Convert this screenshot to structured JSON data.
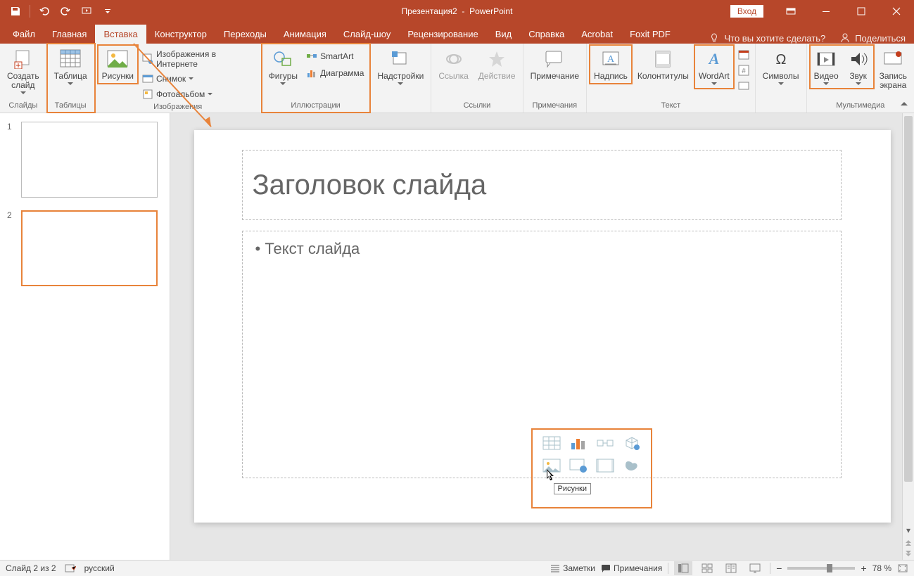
{
  "title": {
    "doc": "Презентация2",
    "app": "PowerPoint",
    "signin": "Вход"
  },
  "qat": {
    "save": "save",
    "undo": "undo",
    "redo": "redo",
    "start": "start"
  },
  "tabs": {
    "file": "Файл",
    "home": "Главная",
    "insert": "Вставка",
    "design": "Конструктор",
    "transitions": "Переходы",
    "animations": "Анимация",
    "slideshow": "Слайд-шоу",
    "review": "Рецензирование",
    "view": "Вид",
    "help": "Справка",
    "acrobat": "Acrobat",
    "foxit": "Foxit PDF",
    "tellme": "Что вы хотите сделать?",
    "share": "Поделиться"
  },
  "ribbon": {
    "groups": {
      "slides": {
        "label": "Слайды",
        "newslide": "Создать\nслайд"
      },
      "tables": {
        "label": "Таблицы",
        "table": "Таблица"
      },
      "images": {
        "label": "Изображения",
        "pictures": "Рисунки",
        "online": "Изображения в Интернете",
        "screenshot": "Снимок",
        "album": "Фотоальбом"
      },
      "illustrations": {
        "label": "Иллюстрации",
        "shapes": "Фигуры",
        "smartart": "SmartArt",
        "chart": "Диаграмма"
      },
      "addins": {
        "label": "",
        "addins": "Надстройки"
      },
      "links": {
        "label": "Ссылки",
        "link": "Ссылка",
        "action": "Действие"
      },
      "comments": {
        "label": "Примечания",
        "comment": "Примечание"
      },
      "text": {
        "label": "Текст",
        "textbox": "Надпись",
        "headerfooter": "Колонтитулы",
        "wordart": "WordArt"
      },
      "symbols": {
        "label": "",
        "symbols": "Символы"
      },
      "media": {
        "label": "Мультимедиа",
        "video": "Видео",
        "audio": "Звук",
        "record": "Запись\nэкрана"
      }
    }
  },
  "thumbs": [
    {
      "num": "1"
    },
    {
      "num": "2"
    }
  ],
  "slide": {
    "title_placeholder": "Заголовок слайда",
    "body_placeholder": "Текст слайда",
    "tooltip": "Рисунки"
  },
  "status": {
    "slide": "Слайд 2 из 2",
    "lang": "русский",
    "notes": "Заметки",
    "comments": "Примечания",
    "zoom": "78 %"
  }
}
